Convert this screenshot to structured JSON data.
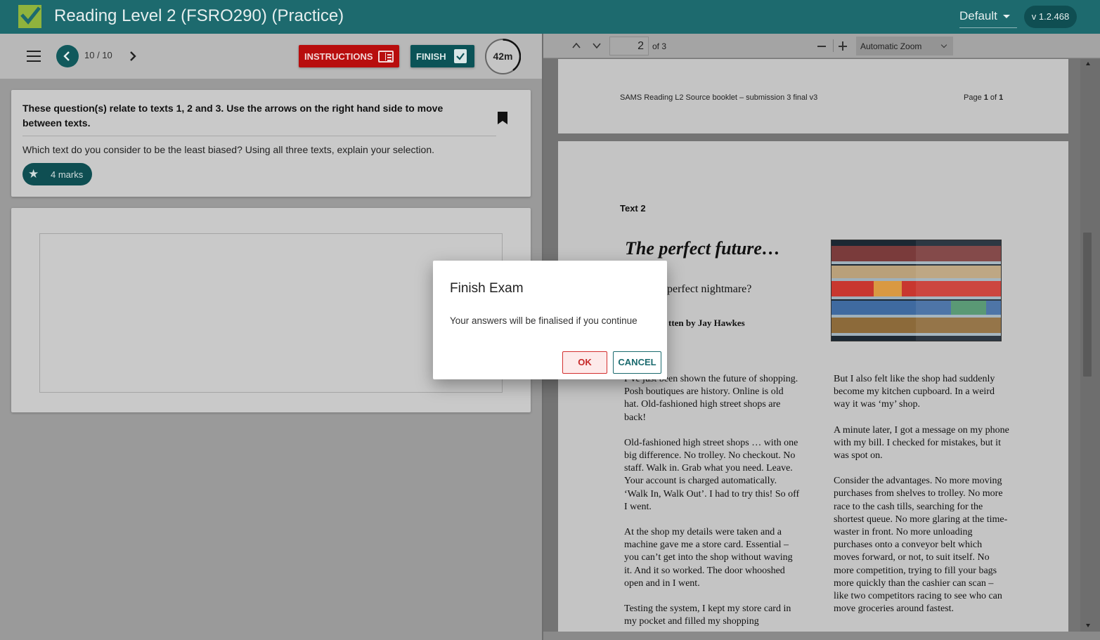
{
  "header": {
    "title": "Reading Level 2 (FSRO290) (Practice)",
    "theme": "Default",
    "version": "v 1.2.468"
  },
  "toolbar": {
    "page_counter": "10 / 10",
    "instructions_label": "INSTRUCTIONS",
    "finish_label": "FINISH",
    "timer": "42m"
  },
  "question": {
    "instruction": "These question(s) relate to texts 1, 2 and 3. Use the arrows on the right hand side to move between texts.",
    "prompt": "Which text do you consider to be the least biased? Using all three texts, explain your selection.",
    "marks": "4 marks"
  },
  "pdf": {
    "page_number": "2",
    "page_of": "of 3",
    "zoom": "Automatic Zoom",
    "page1_header_left": "SAMS Reading L2 Source booklet – submission 3 final v3",
    "page1_header_right_prefix": "Page ",
    "page1_header_right_num": "1",
    "page1_header_right_mid": " of ",
    "page1_header_right_total": "1",
    "text_label": "Text 2",
    "title": "The perfect future…",
    "subtitle": "perfect nightmare?",
    "byline": "tten by Jay Hawkes",
    "left_col": [
      "I’ve just been shown the future of shopping. Posh boutiques are history. Online is old hat. Old-fashioned high street shops are back!",
      "Old-fashioned high street shops … with one big difference. No trolley. No checkout. No staff. Walk in. Grab what you need. Leave. Your account is charged automatically. ‘Walk In, Walk Out’. I had to try this! So off I went.",
      "At the shop my details were taken and a machine gave me a store card. Essential – you can’t get into the shop without waving it. And it so worked. The door whooshed open and in I went.",
      "Testing the system, I kept my store card in my pocket and filled my shopping"
    ],
    "right_col": [
      "But I also felt like the shop had suddenly become my kitchen cupboard. In a weird way it was ‘my’ shop.",
      "A minute later, I got a message on my phone with my bill. I checked for mistakes, but it was spot on.",
      "Consider the advantages. No more moving purchases from shelves to trolley. No more race to the cash tills, searching for the shortest queue. No more glaring at the time-waster in front. No more unloading purchases onto a conveyor belt which moves forward, or not, to suit itself. No more competition, trying to fill your bags more quickly than the cashier can scan – like two competitors racing to see who can move groceries around fastest."
    ]
  },
  "dialog": {
    "title": "Finish Exam",
    "message": "Your answers will be finalised if you continue",
    "ok_label": "OK",
    "cancel_label": "CANCEL"
  }
}
